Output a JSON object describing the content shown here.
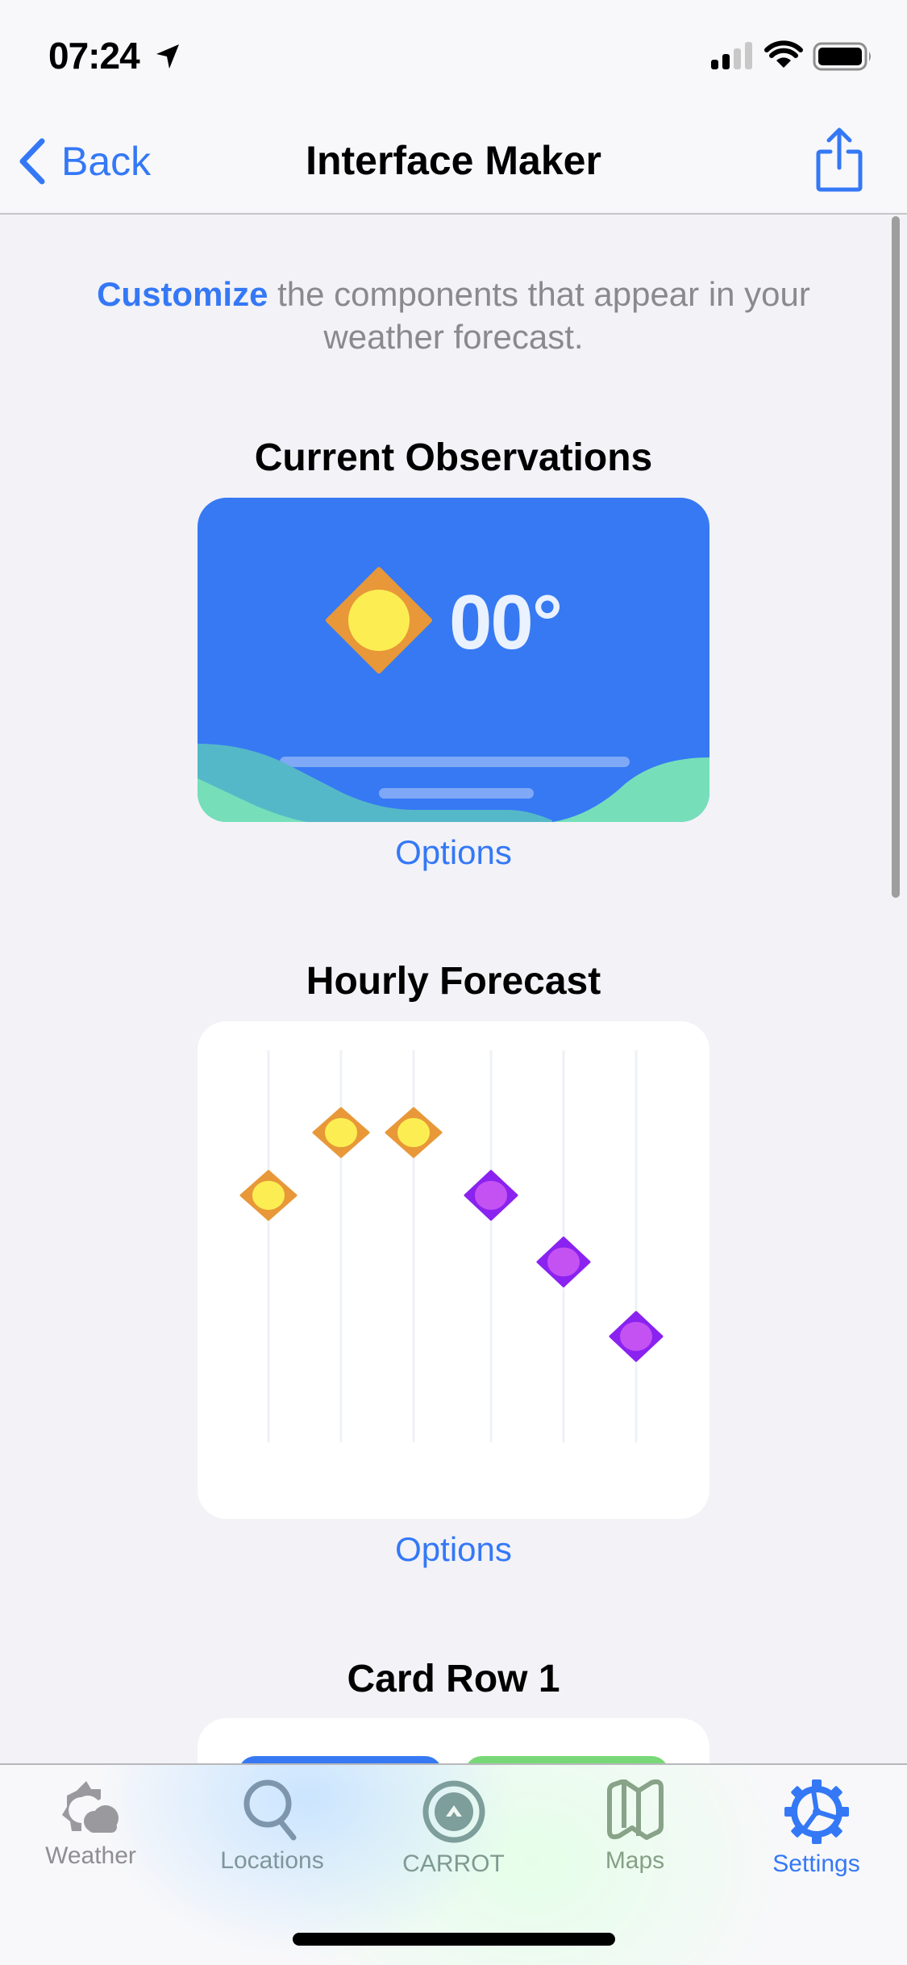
{
  "status_bar": {
    "time": "07:24",
    "location_icon": "location-arrow-icon",
    "signal_icon": "cellular-signal-icon",
    "signal_bars_active": 2,
    "signal_bars_total": 4,
    "wifi_icon": "wifi-icon",
    "battery_icon": "battery-icon",
    "battery_level": 1.0
  },
  "nav": {
    "back_label": "Back",
    "back_icon": "chevron-left-icon",
    "title": "Interface Maker",
    "share_icon": "share-icon"
  },
  "intro": {
    "accent": "Customize",
    "text": " the components that appear in your weather forecast."
  },
  "sections": [
    {
      "title": "Current Observations",
      "options_label": "Options",
      "preview": {
        "temperature": "00°",
        "icon": "sun-icon"
      }
    },
    {
      "title": "Hourly Forecast",
      "options_label": "Options",
      "preview": {
        "icons": [
          "sun-icon",
          "sun-icon",
          "sun-icon",
          "moon-icon",
          "moon-icon",
          "moon-icon"
        ],
        "relative_levels": [
          0.63,
          0.79,
          0.79,
          0.63,
          0.46,
          0.27
        ]
      }
    },
    {
      "title": "Card Row 1"
    }
  ],
  "tabs": [
    {
      "label": "Weather",
      "icon": "weather-sun-cloud-icon",
      "active": false
    },
    {
      "label": "Locations",
      "icon": "search-icon",
      "active": false
    },
    {
      "label": "CARROT",
      "icon": "carrot-logo-icon",
      "active": false
    },
    {
      "label": "Maps",
      "icon": "map-icon",
      "active": false
    },
    {
      "label": "Settings",
      "icon": "gear-icon",
      "active": true
    }
  ],
  "colors": {
    "accent": "#3478f6",
    "background": "#f2f2f7",
    "obs_card": "#3679f3",
    "sun_outer": "#e89838",
    "sun_inner": "#fcee52",
    "moon_outer": "#8a22f0",
    "moon_inner": "#c452f2",
    "hill_front": "#76dfba",
    "hill_back": "#55b8c8",
    "mini_card_blue": "#3679f3",
    "mini_card_green": "#78d877",
    "tab_inactive": "#8e8e93"
  }
}
